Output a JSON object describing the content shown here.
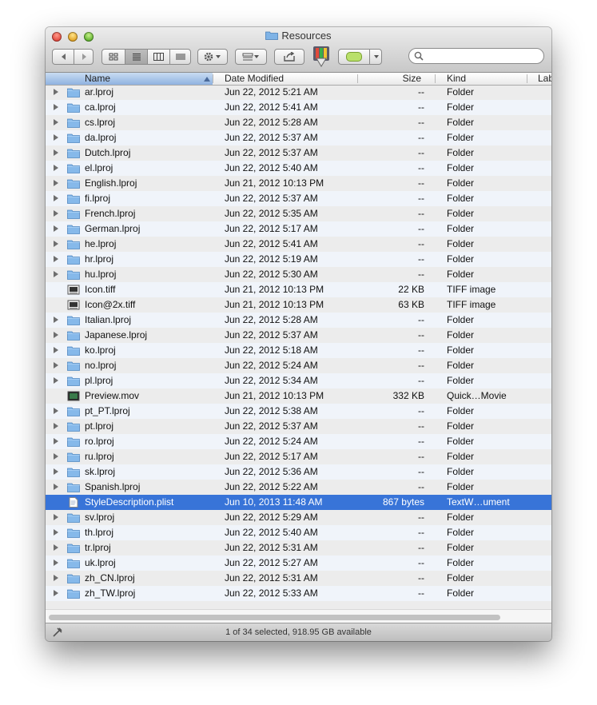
{
  "window": {
    "title": "Resources"
  },
  "toolbar": {
    "back": "back",
    "forward": "forward",
    "views": [
      "icon-view",
      "list-view",
      "column-view",
      "coverflow-view"
    ],
    "action": "action",
    "arrange": "arrange",
    "share": "share",
    "label_color": "#b9e06a"
  },
  "search": {
    "placeholder": ""
  },
  "columns": {
    "name": "Name",
    "date": "Date Modified",
    "size": "Size",
    "kind": "Kind",
    "label": "Lab"
  },
  "files": [
    {
      "name": "ar.lproj",
      "date": "Jun 22, 2012 5:21 AM",
      "size": "--",
      "kind": "Folder",
      "type": "folder"
    },
    {
      "name": "ca.lproj",
      "date": "Jun 22, 2012 5:41 AM",
      "size": "--",
      "kind": "Folder",
      "type": "folder"
    },
    {
      "name": "cs.lproj",
      "date": "Jun 22, 2012 5:28 AM",
      "size": "--",
      "kind": "Folder",
      "type": "folder"
    },
    {
      "name": "da.lproj",
      "date": "Jun 22, 2012 5:37 AM",
      "size": "--",
      "kind": "Folder",
      "type": "folder"
    },
    {
      "name": "Dutch.lproj",
      "date": "Jun 22, 2012 5:37 AM",
      "size": "--",
      "kind": "Folder",
      "type": "folder"
    },
    {
      "name": "el.lproj",
      "date": "Jun 22, 2012 5:40 AM",
      "size": "--",
      "kind": "Folder",
      "type": "folder"
    },
    {
      "name": "English.lproj",
      "date": "Jun 21, 2012 10:13 PM",
      "size": "--",
      "kind": "Folder",
      "type": "folder"
    },
    {
      "name": "fi.lproj",
      "date": "Jun 22, 2012 5:37 AM",
      "size": "--",
      "kind": "Folder",
      "type": "folder"
    },
    {
      "name": "French.lproj",
      "date": "Jun 22, 2012 5:35 AM",
      "size": "--",
      "kind": "Folder",
      "type": "folder"
    },
    {
      "name": "German.lproj",
      "date": "Jun 22, 2012 5:17 AM",
      "size": "--",
      "kind": "Folder",
      "type": "folder"
    },
    {
      "name": "he.lproj",
      "date": "Jun 22, 2012 5:41 AM",
      "size": "--",
      "kind": "Folder",
      "type": "folder"
    },
    {
      "name": "hr.lproj",
      "date": "Jun 22, 2012 5:19 AM",
      "size": "--",
      "kind": "Folder",
      "type": "folder"
    },
    {
      "name": "hu.lproj",
      "date": "Jun 22, 2012 5:30 AM",
      "size": "--",
      "kind": "Folder",
      "type": "folder"
    },
    {
      "name": "Icon.tiff",
      "date": "Jun 21, 2012 10:13 PM",
      "size": "22 KB",
      "kind": "TIFF image",
      "type": "image"
    },
    {
      "name": "Icon@2x.tiff",
      "date": "Jun 21, 2012 10:13 PM",
      "size": "63 KB",
      "kind": "TIFF image",
      "type": "image"
    },
    {
      "name": "Italian.lproj",
      "date": "Jun 22, 2012 5:28 AM",
      "size": "--",
      "kind": "Folder",
      "type": "folder"
    },
    {
      "name": "Japanese.lproj",
      "date": "Jun 22, 2012 5:37 AM",
      "size": "--",
      "kind": "Folder",
      "type": "folder"
    },
    {
      "name": "ko.lproj",
      "date": "Jun 22, 2012 5:18 AM",
      "size": "--",
      "kind": "Folder",
      "type": "folder"
    },
    {
      "name": "no.lproj",
      "date": "Jun 22, 2012 5:24 AM",
      "size": "--",
      "kind": "Folder",
      "type": "folder"
    },
    {
      "name": "pl.lproj",
      "date": "Jun 22, 2012 5:34 AM",
      "size": "--",
      "kind": "Folder",
      "type": "folder"
    },
    {
      "name": "Preview.mov",
      "date": "Jun 21, 2012 10:13 PM",
      "size": "332 KB",
      "kind": "Quick…Movie",
      "type": "movie"
    },
    {
      "name": "pt_PT.lproj",
      "date": "Jun 22, 2012 5:38 AM",
      "size": "--",
      "kind": "Folder",
      "type": "folder"
    },
    {
      "name": "pt.lproj",
      "date": "Jun 22, 2012 5:37 AM",
      "size": "--",
      "kind": "Folder",
      "type": "folder"
    },
    {
      "name": "ro.lproj",
      "date": "Jun 22, 2012 5:24 AM",
      "size": "--",
      "kind": "Folder",
      "type": "folder"
    },
    {
      "name": "ru.lproj",
      "date": "Jun 22, 2012 5:17 AM",
      "size": "--",
      "kind": "Folder",
      "type": "folder"
    },
    {
      "name": "sk.lproj",
      "date": "Jun 22, 2012 5:36 AM",
      "size": "--",
      "kind": "Folder",
      "type": "folder"
    },
    {
      "name": "Spanish.lproj",
      "date": "Jun 22, 2012 5:22 AM",
      "size": "--",
      "kind": "Folder",
      "type": "folder"
    },
    {
      "name": "StyleDescription.plist",
      "date": "Jun 10, 2013 11:48 AM",
      "size": "867 bytes",
      "kind": "TextW…ument",
      "type": "plist",
      "selected": true
    },
    {
      "name": "sv.lproj",
      "date": "Jun 22, 2012 5:29 AM",
      "size": "--",
      "kind": "Folder",
      "type": "folder"
    },
    {
      "name": "th.lproj",
      "date": "Jun 22, 2012 5:40 AM",
      "size": "--",
      "kind": "Folder",
      "type": "folder"
    },
    {
      "name": "tr.lproj",
      "date": "Jun 22, 2012 5:31 AM",
      "size": "--",
      "kind": "Folder",
      "type": "folder"
    },
    {
      "name": "uk.lproj",
      "date": "Jun 22, 2012 5:27 AM",
      "size": "--",
      "kind": "Folder",
      "type": "folder"
    },
    {
      "name": "zh_CN.lproj",
      "date": "Jun 22, 2012 5:31 AM",
      "size": "--",
      "kind": "Folder",
      "type": "folder"
    },
    {
      "name": "zh_TW.lproj",
      "date": "Jun 22, 2012 5:33 AM",
      "size": "--",
      "kind": "Folder",
      "type": "folder"
    }
  ],
  "status": {
    "text": "1 of 34 selected, 918.95 GB available"
  }
}
